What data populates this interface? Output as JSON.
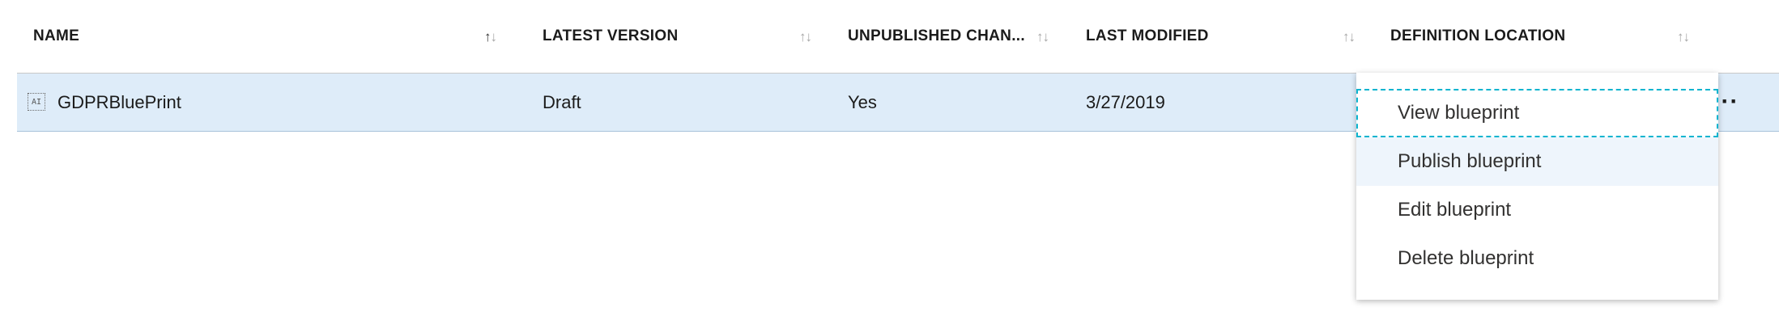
{
  "table": {
    "columns": [
      {
        "label": "NAME",
        "sort_icon": "sort-ascending-icon",
        "active_sort": true
      },
      {
        "label": "LATEST VERSION",
        "sort_icon": "sort-icon"
      },
      {
        "label": "UNPUBLISHED CHAN...",
        "sort_icon": "sort-icon"
      },
      {
        "label": "LAST MODIFIED",
        "sort_icon": "sort-icon"
      },
      {
        "label": "DEFINITION LOCATION",
        "sort_icon": "sort-icon"
      }
    ],
    "rows": [
      {
        "icon": "blueprint-icon",
        "icon_glyph": "AI",
        "name": "GDPRBluePrint",
        "latest_version": "Draft",
        "unpublished_changes": "Yes",
        "last_modified": "3/27/2019",
        "definition_location": ""
      }
    ],
    "more_actions_glyph": "···"
  },
  "context_menu": {
    "items": [
      {
        "label": "View blueprint",
        "state": "focused"
      },
      {
        "label": "Publish blueprint",
        "state": "hover"
      },
      {
        "label": "Edit blueprint",
        "state": "normal"
      },
      {
        "label": "Delete blueprint",
        "state": "normal"
      }
    ]
  },
  "colors": {
    "selected_row": "#deecf9",
    "focus_outline": "#0ab4cf",
    "menu_hover": "#eef5fc"
  },
  "sort_glyphs": {
    "up": "↑",
    "down": "↓"
  }
}
